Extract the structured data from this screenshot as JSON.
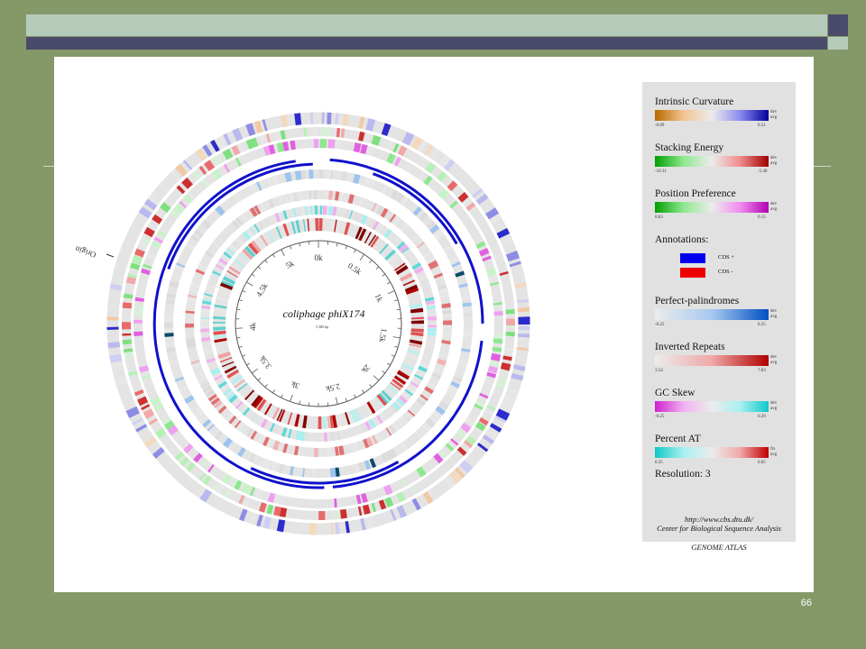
{
  "slide": {
    "page_number": "66",
    "colors": {
      "background": "#859868",
      "bar_light": "#b5cbba",
      "bar_dark": "#4a4a6a",
      "panel": "#ffffff"
    }
  },
  "atlas": {
    "organism": "coliphage phiX174",
    "genome_size": "5,386 bp",
    "origin_label": "Origin",
    "ticks": [
      "0k",
      "0.5k",
      "1k",
      "1.5k",
      "2k",
      "2.5k",
      "3k",
      "3.5k",
      "4k",
      "4.5k",
      "5k"
    ]
  },
  "legend": {
    "intrinsic_curvature": {
      "label": "Intrinsic Curvature",
      "min": "-0.09",
      "max": "0.51",
      "mode1": "dev",
      "mode2": "avg"
    },
    "stacking_energy": {
      "label": "Stacking Energy",
      "min": "-10.31",
      "max": "-5.40",
      "mode1": "dev",
      "mode2": "avg"
    },
    "position_preference": {
      "label": "Position Preference",
      "min": "0.03",
      "max": "0.15",
      "mode1": "dev",
      "mode2": "avg"
    },
    "annotations": {
      "label": "Annotations:",
      "cds_plus": "CDS +",
      "cds_minus": "CDS -"
    },
    "perfect_palindromes": {
      "label": "Perfect-palindromes",
      "min": "-0.25",
      "max": "0.25",
      "mode1": "dev",
      "mode2": "avg"
    },
    "inverted_repeats": {
      "label": "Inverted Repeats",
      "min": "3.54",
      "max": "7.83",
      "mode1": "dev",
      "mode2": "avg"
    },
    "gc_skew": {
      "label": "GC Skew",
      "min": "-0.25",
      "max": "0.29",
      "mode1": "dev",
      "mode2": "avg"
    },
    "percent_at": {
      "label": "Percent AT",
      "min": "0.35",
      "max": "0.65",
      "mode1": "fix",
      "mode2": "avg"
    },
    "resolution": "Resolution: 3",
    "url": "http://www.cbs.dtu.dk/",
    "center": "Center for Biological Sequence Analysis",
    "atlas_name": "GENOME ATLAS"
  }
}
